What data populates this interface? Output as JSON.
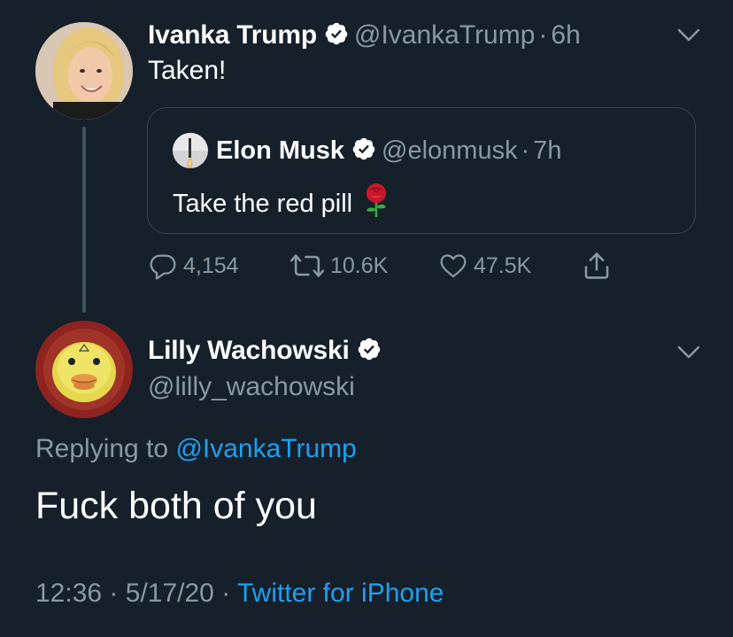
{
  "parent_tweet": {
    "author_name": "Ivanka Trump",
    "author_handle": "@IvankaTrump",
    "separator": "·",
    "time_ago": "6h",
    "text": "Taken!",
    "avatar_icon": "profile-photo-blonde-woman",
    "verified_icon": "verified-badge-icon",
    "menu_icon": "chevron-down-icon"
  },
  "quoted_tweet": {
    "author_name": "Elon Musk",
    "author_handle": "@elonmusk",
    "separator": "·",
    "time_ago": "7h",
    "text": "Take the red pill",
    "emoji": "rose-emoji",
    "avatar_icon": "rocket-launch-avatar"
  },
  "actions": {
    "replies": "4,154",
    "retweets": "10.6K",
    "likes": "47.5K",
    "reply_icon": "reply-bubble-icon",
    "retweet_icon": "retweet-icon",
    "like_icon": "heart-icon",
    "share_icon": "share-icon"
  },
  "reply_tweet": {
    "author_name": "Lilly Wachowski",
    "author_handle": "@lilly_wachowski",
    "replying_prefix": "Replying to",
    "replying_to": "@IvankaTrump",
    "text": "Fuck both of you",
    "timestamp_time": "12:36",
    "separator": "·",
    "timestamp_date": "5/17/20",
    "source": "Twitter for iPhone",
    "avatar_icon": "yellow-duck-avatar",
    "menu_icon": "chevron-down-icon"
  },
  "colors": {
    "background": "#15202b",
    "text": "#ffffff",
    "muted": "#8899a6",
    "link": "#1da1f2",
    "border": "#38444d"
  }
}
